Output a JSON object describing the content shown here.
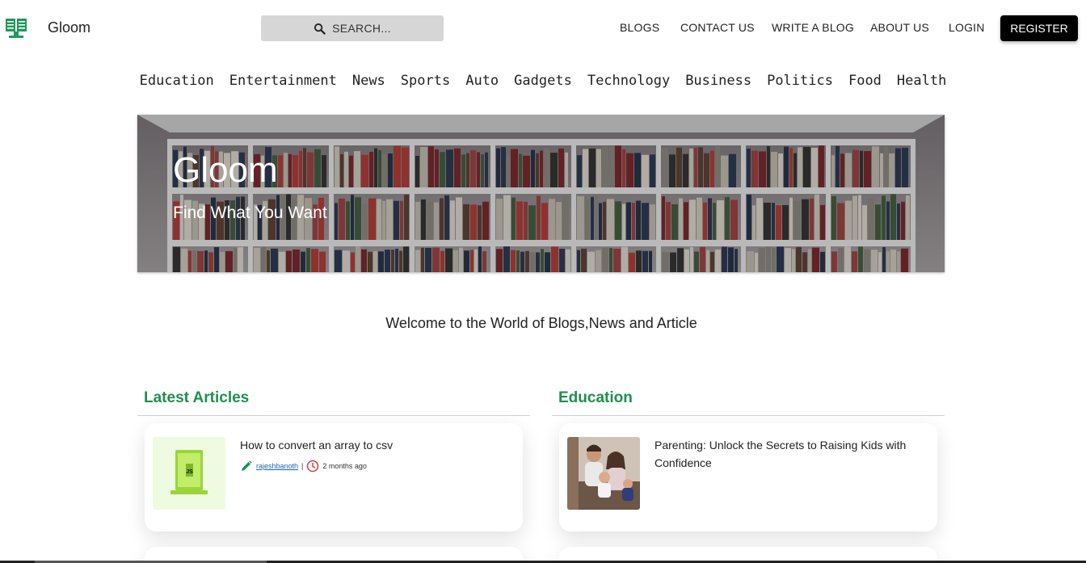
{
  "header": {
    "brand": "Gloom",
    "search_placeholder": "SEARCH...",
    "nav": [
      "BLOGS",
      "CONTACT US",
      "WRITE A BLOG",
      "ABOUT US",
      "LOGIN"
    ],
    "register": "REGISTER"
  },
  "categories": [
    "Education",
    "Entertainment",
    "News",
    "Sports",
    "Auto",
    "Gadgets",
    "Technology",
    "Business",
    "Politics",
    "Food",
    "Health"
  ],
  "hero": {
    "title": "Gloom",
    "subtitle": "Find What You Want"
  },
  "welcome": "Welcome to the World of Blogs,News and Article",
  "sections": [
    {
      "heading": "Latest Articles",
      "card": {
        "title": "How to convert an array to csv",
        "author": "rajeshbanoth",
        "separator": "|",
        "time": "2 months ago",
        "thumb_icon": "js-laptop-icon"
      }
    },
    {
      "heading": "Education",
      "card": {
        "title": "Parenting: Unlock the Secrets to Raising Kids with Confidence",
        "thumb_icon": "family-photo"
      }
    }
  ],
  "colors": {
    "accent": "#1f8f4d",
    "register_bg": "#000000",
    "search_bg": "#d6d6d6"
  }
}
